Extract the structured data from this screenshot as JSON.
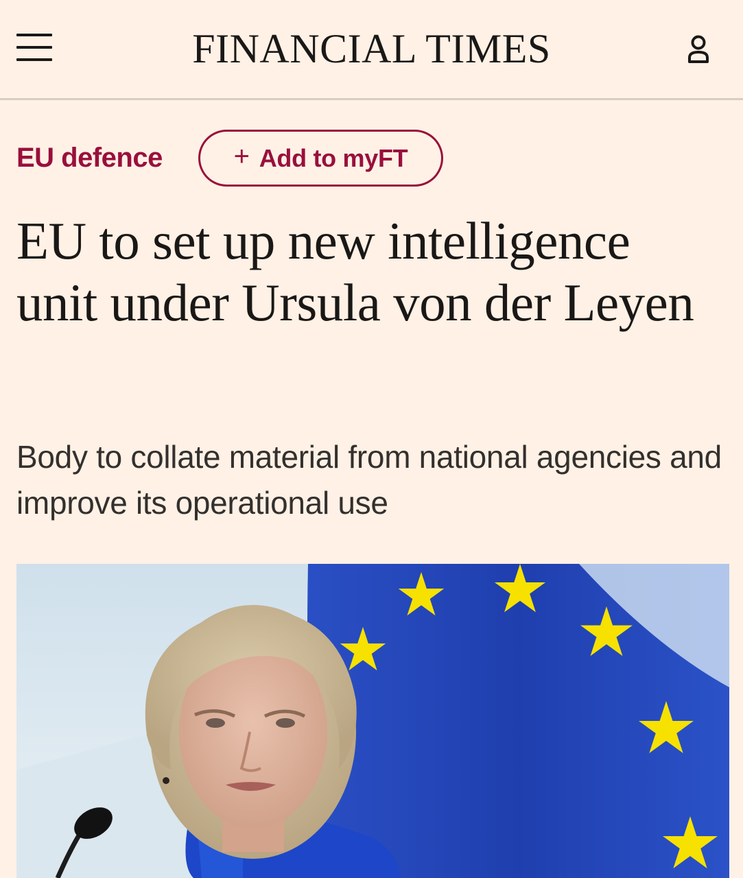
{
  "header": {
    "masthead": "FINANCIAL TIMES",
    "menu_icon": "hamburger-menu-icon",
    "account_icon": "user-account-icon"
  },
  "article": {
    "topic": "EU defence",
    "add_to_myft": {
      "symbol": "+",
      "label": "Add to myFT"
    },
    "headline": "EU to set up new intelligence unit under Ursula von der Leyen",
    "standfirst": "Body to collate material from national agencies and improve its operational use"
  },
  "colors": {
    "background": "#FFF1E5",
    "accent": "#990F3D",
    "text": "#1A1817",
    "flag_blue": "#1F3FAE",
    "star_yellow": "#F6E100"
  }
}
